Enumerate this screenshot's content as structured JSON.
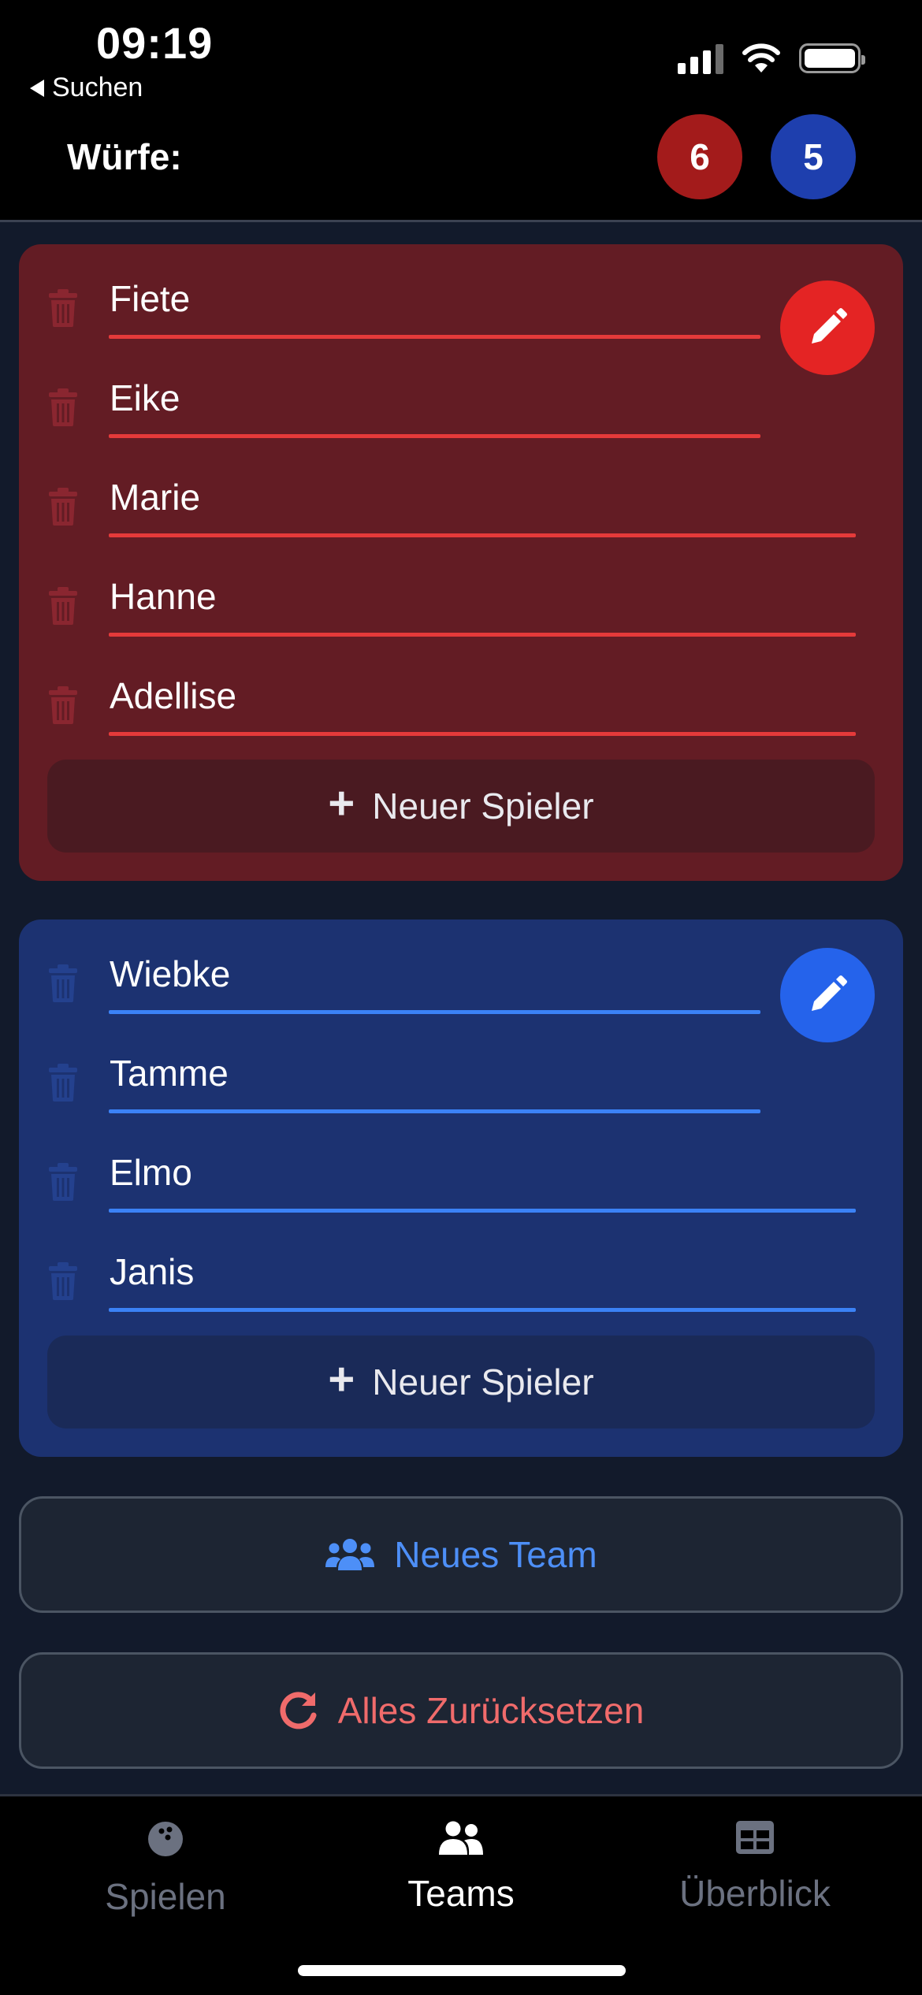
{
  "status_bar": {
    "time": "09:19",
    "back_label": "Suchen"
  },
  "header": {
    "throws_label": "Würfe:",
    "throws_red": "6",
    "throws_blue": "5"
  },
  "colors": {
    "red_team": "#631c24",
    "blue_team": "#1c3271",
    "red_accent": "#e42424",
    "blue_accent": "#2563eb",
    "background": "#121a2b"
  },
  "teams": [
    {
      "color": "red",
      "players": [
        "Fiete",
        "Eike",
        "Marie",
        "Hanne",
        "Adellise"
      ],
      "add_player_label": "Neuer Spieler"
    },
    {
      "color": "blue",
      "players": [
        "Wiebke",
        "Tamme",
        "Elmo",
        "Janis"
      ],
      "add_player_label": "Neuer Spieler"
    }
  ],
  "actions": {
    "new_team_label": "Neues Team",
    "reset_label": "Alles Zurücksetzen"
  },
  "tabs": [
    {
      "label": "Spielen",
      "icon": "bowling-ball-icon",
      "active": false
    },
    {
      "label": "Teams",
      "icon": "users-icon",
      "active": true
    },
    {
      "label": "Überblick",
      "icon": "table-icon",
      "active": false
    }
  ]
}
